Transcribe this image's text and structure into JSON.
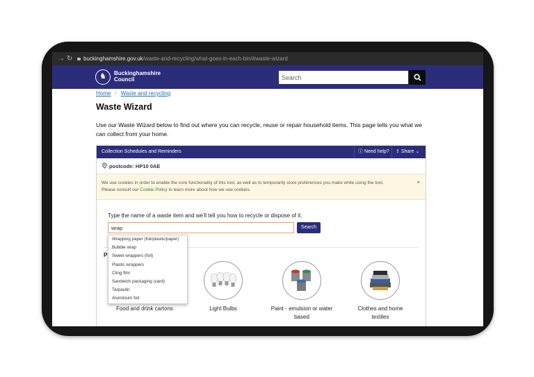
{
  "browser": {
    "url_domain": "buckinghamshire.gov.uk",
    "url_path": "/waste-and-recycling/what-goes-in-each-bin/#waste-wizard"
  },
  "header": {
    "logo_line1": "Buckinghamshire",
    "logo_line2": "Council",
    "search_placeholder": "Search"
  },
  "breadcrumb": [
    "Home",
    "Waste and recycling"
  ],
  "page": {
    "title": "Waste Wizard",
    "intro": "Use our Waste Wizard below to find out where you can recycle, reuse or repair household items. This page tells you what we can collect from your home."
  },
  "widget": {
    "bar_title": "Collection Schedules and Reminders",
    "need_help": "Need help?",
    "share": "Share",
    "postcode": "postcode: HP10 0AE",
    "cookie_text_1": "We use cookies in order to enable the core functionality of this tool, as well as to temporarily store preferences you make while using the tool.",
    "cookie_text_2": "Please consult our ",
    "cookie_link": "Cookie Policy",
    "cookie_text_3": " to learn more about how we use cookies.",
    "cookie_close": "×",
    "prompt": "Type the name of a waste item and we'll tell you how to recycle or dispose of it.",
    "input_value": "wrap",
    "search_button": "Search",
    "popular_label": "P"
  },
  "autocomplete": [
    "Wrapping paper (foil/plastic/paper)",
    "Bubble wrap",
    "Sweet wrappers (foil)",
    "Plastic wrappers",
    "Cling film",
    "Sandwich packaging (card)",
    "Tarpaulin",
    "Aluminium foil"
  ],
  "tiles": [
    {
      "label": "Food and drink cartons"
    },
    {
      "label": "Light Bulbs"
    },
    {
      "label": "Paint - emulsion or water based"
    },
    {
      "label": "Clothes and home textiles"
    }
  ],
  "colors": {
    "brand": "#2b2c7a",
    "link": "#1d70b8",
    "cookie_bg": "#fdf6e3"
  }
}
